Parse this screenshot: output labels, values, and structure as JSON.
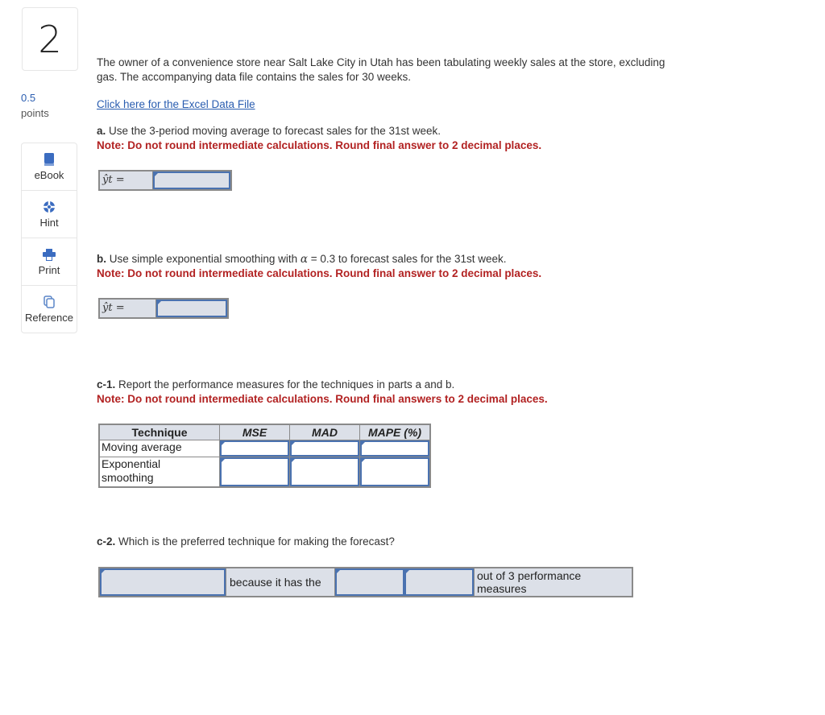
{
  "question": {
    "number": "2",
    "points_value": "0.5",
    "points_label": "points"
  },
  "tools": [
    {
      "label": "eBook",
      "icon": "book-icon"
    },
    {
      "label": "Hint",
      "icon": "lifebuoy-icon"
    },
    {
      "label": "Print",
      "icon": "printer-icon"
    },
    {
      "label": "Reference",
      "icon": "copy-icon"
    }
  ],
  "intro": {
    "line1": "The owner of a convenience store near Salt Lake City in Utah has been tabulating weekly sales at the store, excluding",
    "line2": "gas. The accompanying data file contains the sales for 30 weeks.",
    "link": "Click here for the Excel Data File"
  },
  "part_a": {
    "label": "a.",
    "text": " Use the 3-period moving average to forecast sales for the 31st week.",
    "note": "Note: Do not round intermediate calculations. Round final answer to 2 decimal places.",
    "answer_label": "ŷt =",
    "answer_value": ""
  },
  "part_b": {
    "label": "b.",
    "text_pre": " Use simple exponential smoothing with ",
    "alpha_symbol": "α",
    "text_post": " = 0.3 to forecast sales for the 31st week.",
    "note": "Note: Do not round intermediate calculations. Round final answer to 2 decimal places.",
    "answer_label": "ŷt =",
    "answer_value": ""
  },
  "part_c1": {
    "label": "c-1.",
    "text": " Report the performance measures for the techniques in parts a and b.",
    "note": "Note: Do not round intermediate calculations. Round final answers to 2 decimal places.",
    "table": {
      "headers": [
        "Technique",
        "MSE",
        "MAD",
        "MAPE (%)"
      ],
      "rows": [
        {
          "technique": "Moving average",
          "mse": "",
          "mad": "",
          "mape": ""
        },
        {
          "technique": "Exponential smoothing",
          "technique_line1": "Exponential",
          "technique_line2": "smoothing",
          "mse": "",
          "mad": "",
          "mape": ""
        }
      ]
    }
  },
  "part_c2": {
    "label": "c-2.",
    "text": " Which is the preferred technique for making the forecast?",
    "because_text": "because it has the",
    "out_of_line1": "out of 3 performance",
    "out_of_line2": "measures",
    "technique_value": "",
    "comparison_value": "",
    "count_value": ""
  }
}
